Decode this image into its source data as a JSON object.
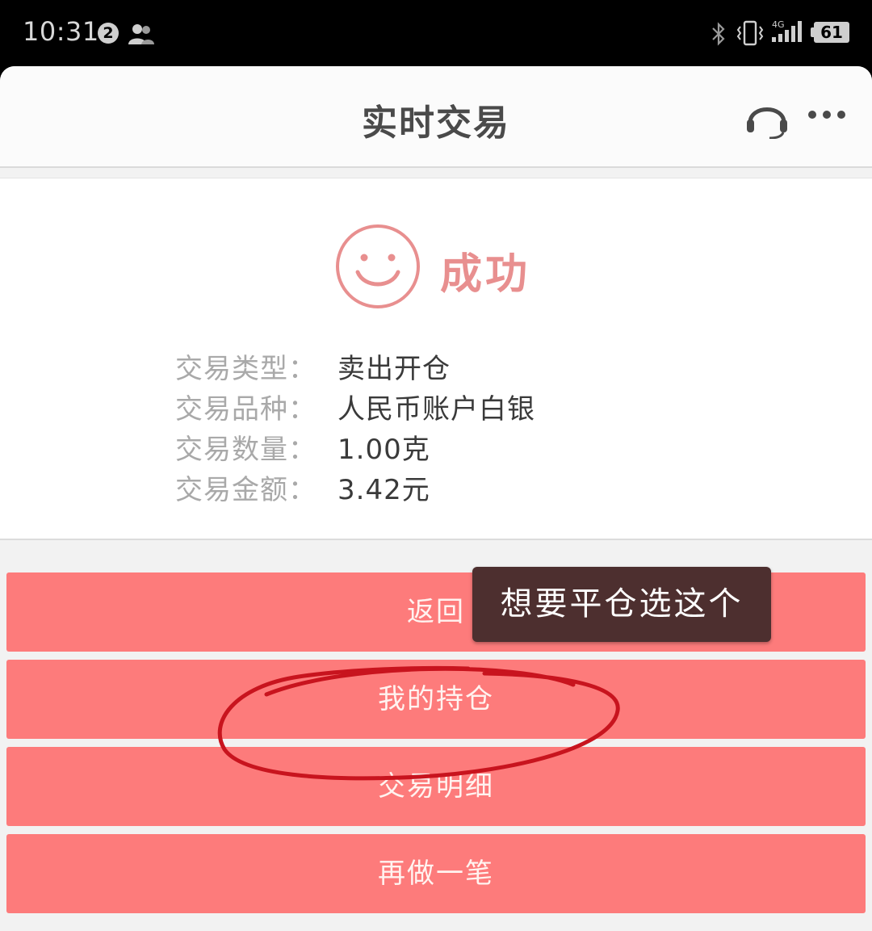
{
  "status_bar": {
    "time": "10:31",
    "notification_count": "2",
    "network": "4G",
    "battery": "61"
  },
  "nav": {
    "title": "实时交易",
    "headset_icon": "headset-icon",
    "more_icon": "more-icon"
  },
  "result": {
    "status_icon": "smile-icon",
    "status_text": "成功",
    "status_color": "#e88f8f",
    "rows": [
      {
        "label": "交易类型：",
        "value": "卖出开仓"
      },
      {
        "label": "交易品种：",
        "value": "人民币账户白银"
      },
      {
        "label": "交易数量：",
        "value": "1.00克"
      },
      {
        "label": "交易金额：",
        "value": "3.42元"
      }
    ]
  },
  "buttons": {
    "back": "返回",
    "holdings": "我的持仓",
    "details": "交易明细",
    "again": "再做一笔",
    "color": "#fd7b7b"
  },
  "annotation": {
    "tooltip_text": "想要平仓选这个",
    "circle_color": "#c8141e"
  }
}
